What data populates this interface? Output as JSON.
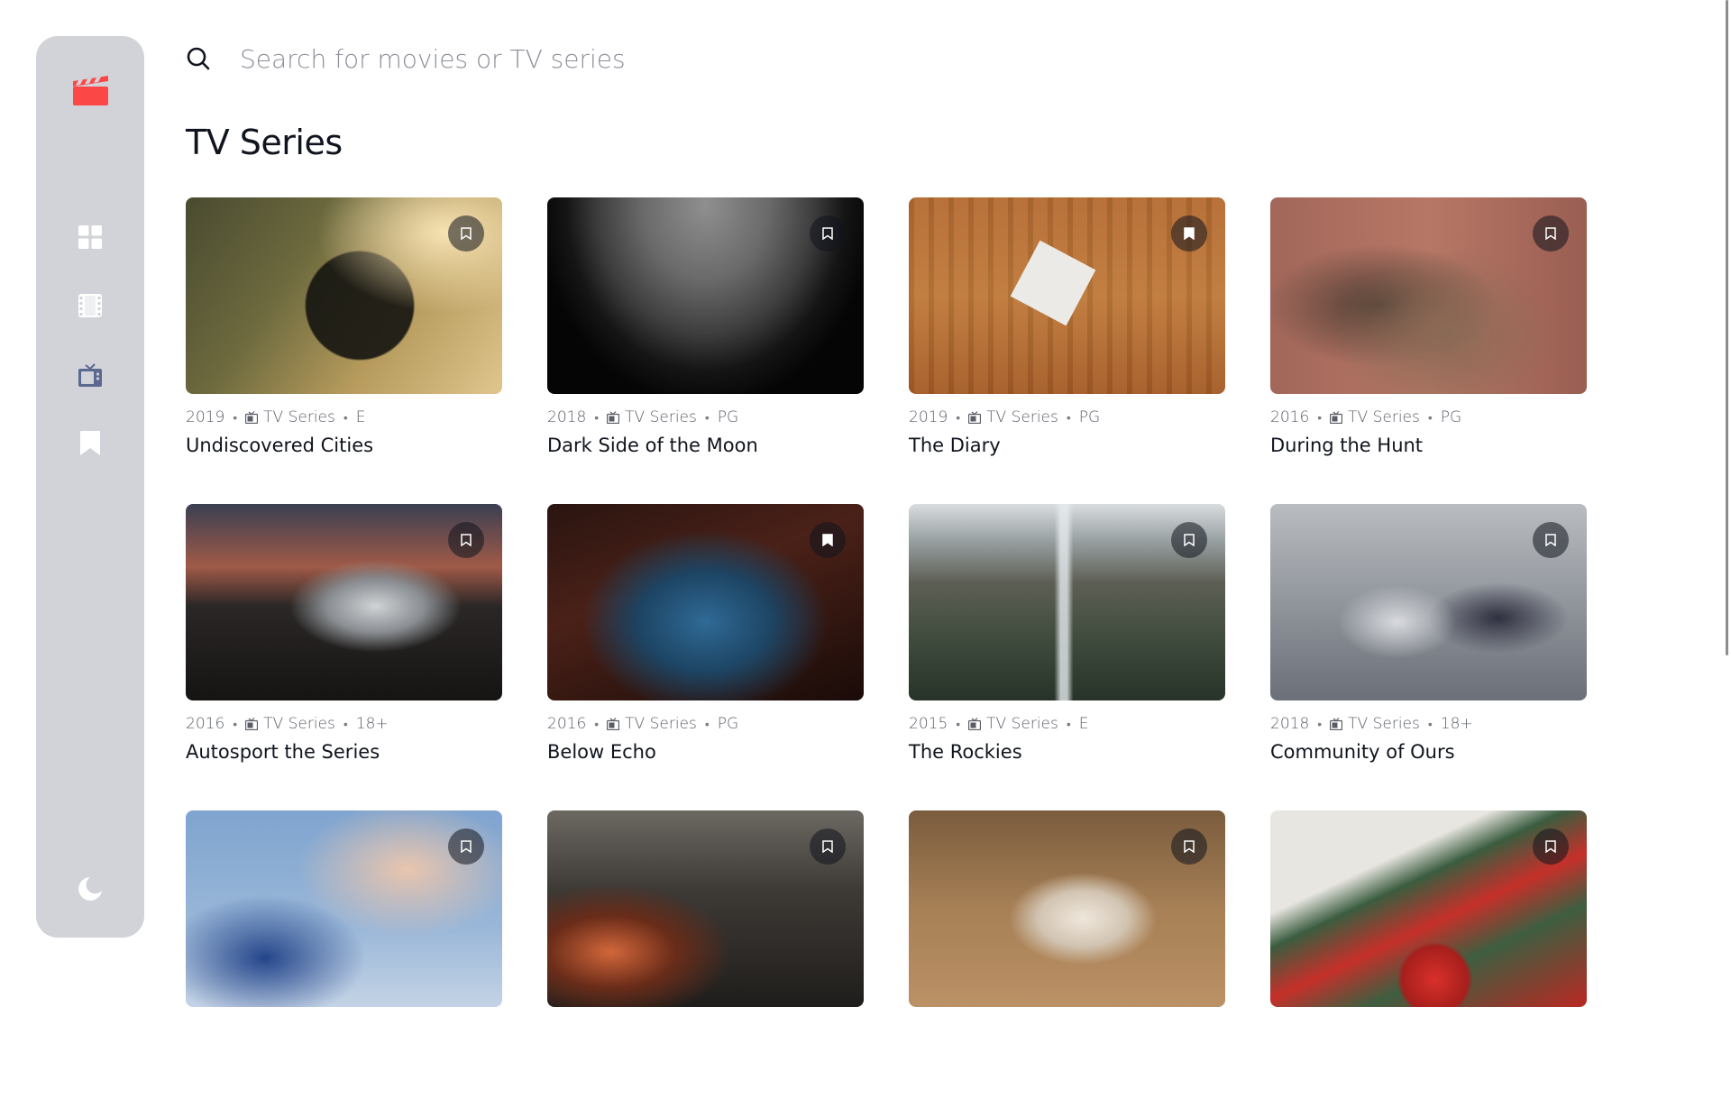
{
  "app": {
    "brand_color": "#fc4747",
    "background": "#ffffff",
    "sidebar_color": "#d1d3d9"
  },
  "sidebar": {
    "logo_icon": "clapperboard-icon",
    "items": [
      {
        "name": "home",
        "icon": "grid-icon"
      },
      {
        "name": "movies",
        "icon": "film-icon"
      },
      {
        "name": "tv-series",
        "icon": "tv-icon",
        "active": true
      },
      {
        "name": "bookmarks",
        "icon": "bookmark-icon"
      }
    ],
    "theme_toggle_icon": "moon-icon"
  },
  "search": {
    "placeholder": "Search for movies or TV series",
    "value": ""
  },
  "page": {
    "title": "TV Series"
  },
  "cards": [
    {
      "year": "2019",
      "category": "TV Series",
      "rating": "E",
      "title": "Undiscovered Cities",
      "bookmarked": false
    },
    {
      "year": "2018",
      "category": "TV Series",
      "rating": "PG",
      "title": "Dark Side of the Moon",
      "bookmarked": false
    },
    {
      "year": "2019",
      "category": "TV Series",
      "rating": "PG",
      "title": "The Diary",
      "bookmarked": true
    },
    {
      "year": "2016",
      "category": "TV Series",
      "rating": "PG",
      "title": "During the Hunt",
      "bookmarked": false
    },
    {
      "year": "2016",
      "category": "TV Series",
      "rating": "18+",
      "title": "Autosport the Series",
      "bookmarked": false
    },
    {
      "year": "2016",
      "category": "TV Series",
      "rating": "PG",
      "title": "Below Echo",
      "bookmarked": true
    },
    {
      "year": "2015",
      "category": "TV Series",
      "rating": "E",
      "title": "The Rockies",
      "bookmarked": false
    },
    {
      "year": "2018",
      "category": "TV Series",
      "rating": "18+",
      "title": "Community of Ours",
      "bookmarked": false
    },
    {
      "bookmarked": false
    },
    {
      "bookmarked": false
    },
    {
      "bookmarked": false
    },
    {
      "bookmarked": false
    }
  ]
}
